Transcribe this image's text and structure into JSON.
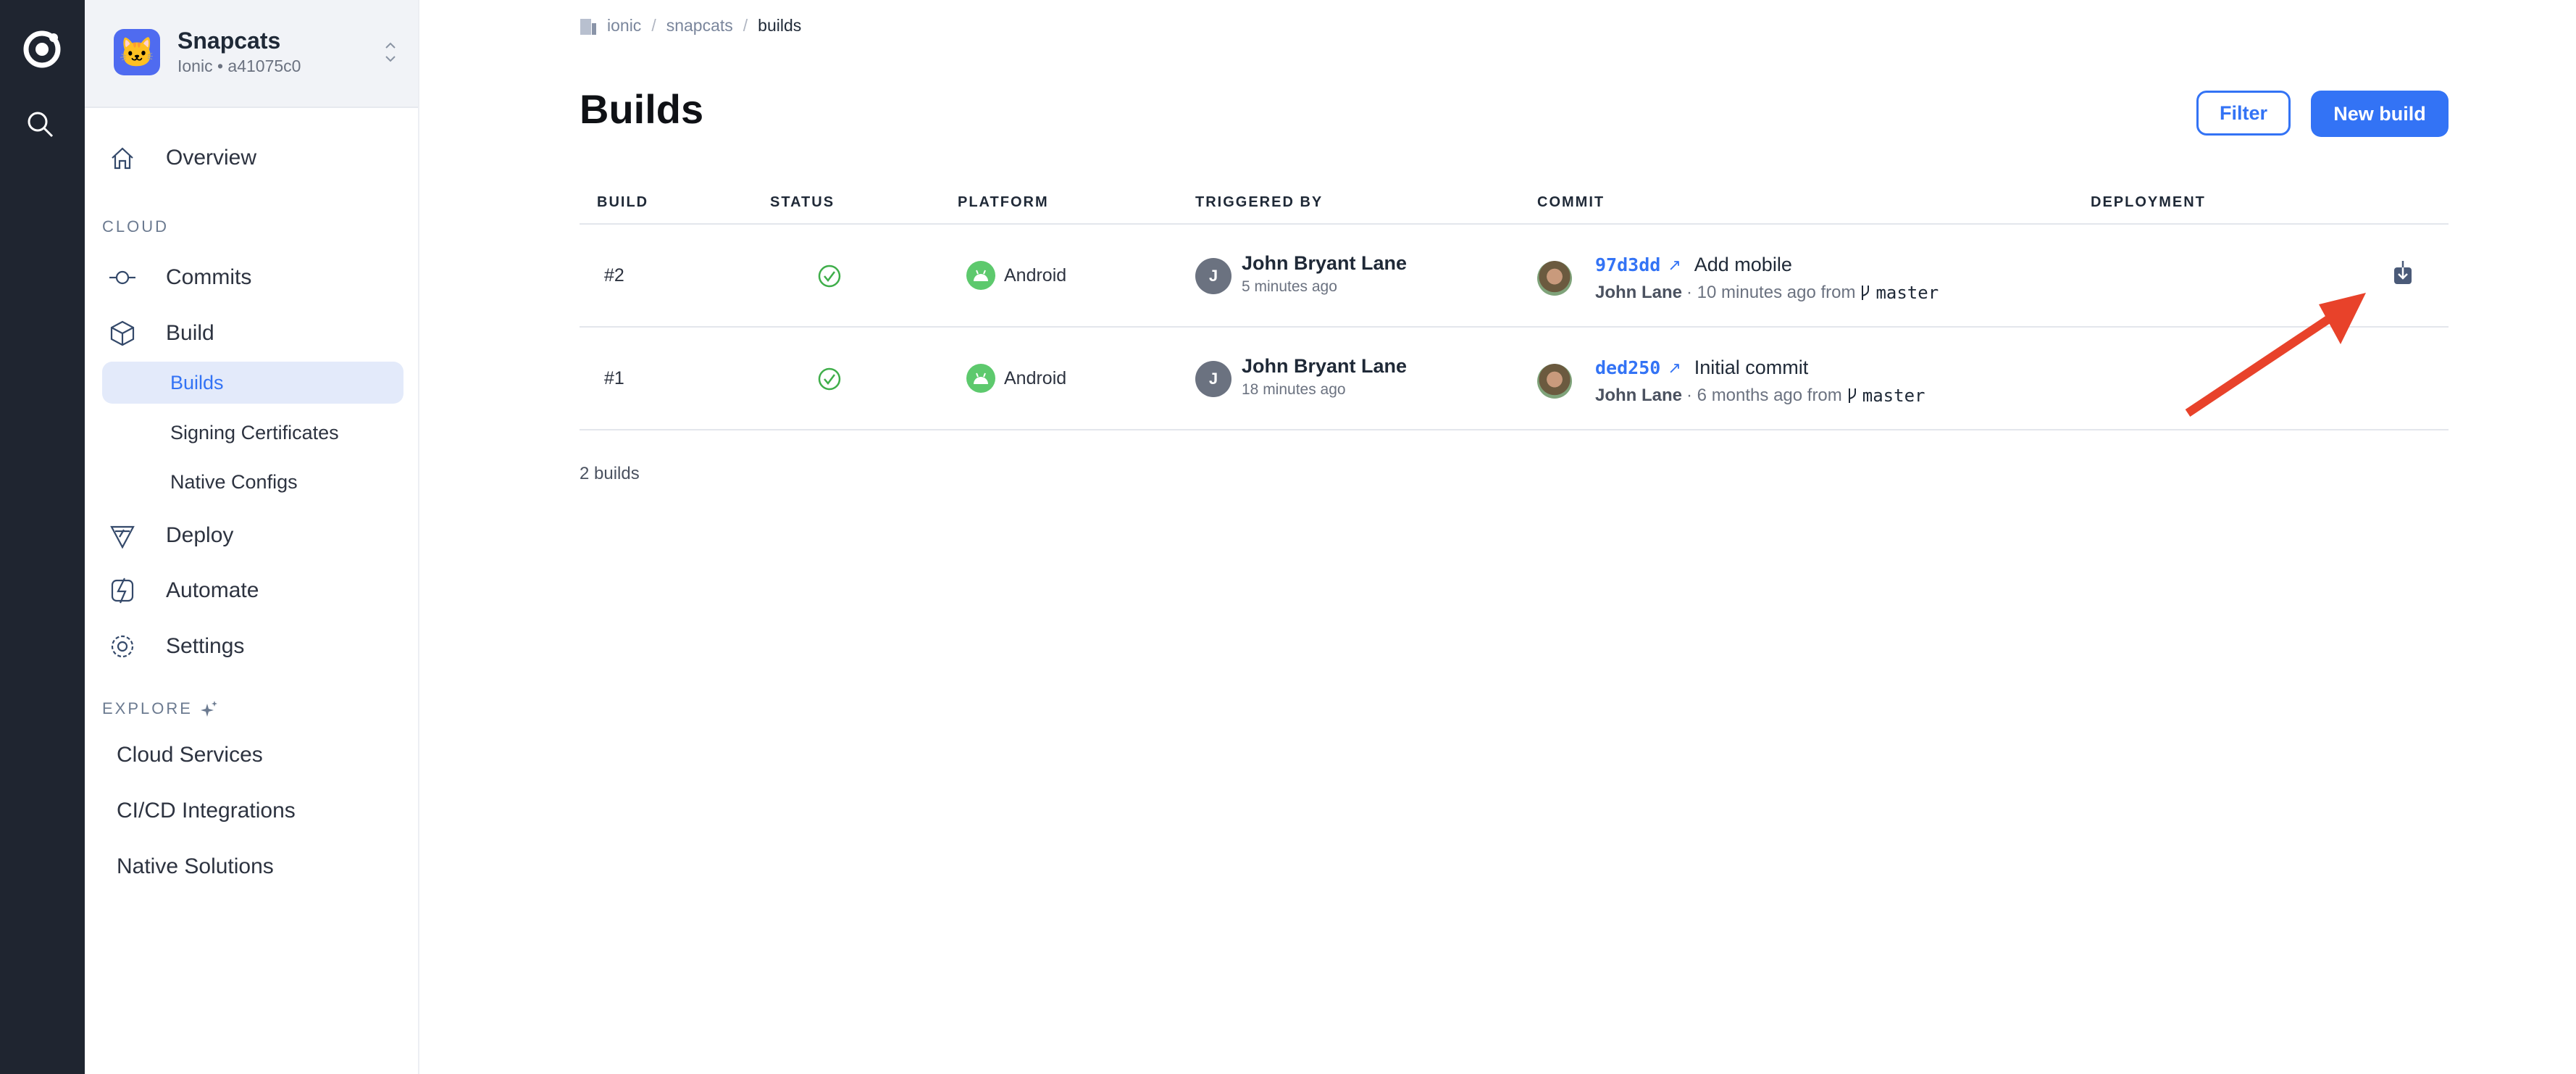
{
  "rail": {
    "logo_icon": "ionic-logo-icon",
    "search_icon": "search-icon"
  },
  "app": {
    "name": "Snapcats",
    "subtitle": "Ionic • a41075c0",
    "icon": "cat-face"
  },
  "nav": {
    "overview": "Overview",
    "cloud_section": "CLOUD",
    "commits": "Commits",
    "build": "Build",
    "build_children": [
      "Builds",
      "Signing Certificates",
      "Native Configs"
    ],
    "active_child": "Builds",
    "deploy": "Deploy",
    "automate": "Automate",
    "settings": "Settings",
    "explore_section": "EXPLORE",
    "explore_items": [
      "Cloud Services",
      "CI/CD Integrations",
      "Native Solutions"
    ]
  },
  "breadcrumb": [
    "ionic",
    "snapcats",
    "builds"
  ],
  "page": {
    "title": "Builds",
    "filter_label": "Filter",
    "new_build_label": "New build"
  },
  "table": {
    "columns": [
      "BUILD",
      "STATUS",
      "PLATFORM",
      "TRIGGERED BY",
      "COMMIT",
      "DEPLOYMENT"
    ],
    "rows": [
      {
        "build": "#2",
        "status": "success",
        "platform": "Android",
        "triggered_by": "John Bryant Lane",
        "triggered_initial": "J",
        "triggered_time": "5 minutes ago",
        "commit_hash": "97d3dd",
        "commit_message": "Add mobile",
        "commit_author": "John Lane",
        "commit_meta": "· 10 minutes ago from",
        "branch": "master",
        "deployment_icon": "download-icon"
      },
      {
        "build": "#1",
        "status": "success",
        "platform": "Android",
        "triggered_by": "John Bryant Lane",
        "triggered_initial": "J",
        "triggered_time": "18 minutes ago",
        "commit_hash": "ded250",
        "commit_message": "Initial commit",
        "commit_author": "John Lane",
        "commit_meta": "· 6 months ago from",
        "branch": "master",
        "deployment_icon": ""
      }
    ],
    "footer": "2 builds"
  },
  "colors": {
    "accent": "#3373f5",
    "rail": "#1f2530",
    "success": "#3fae4a",
    "android": "#5dc96d",
    "annotation_arrow": "#e8422a"
  }
}
